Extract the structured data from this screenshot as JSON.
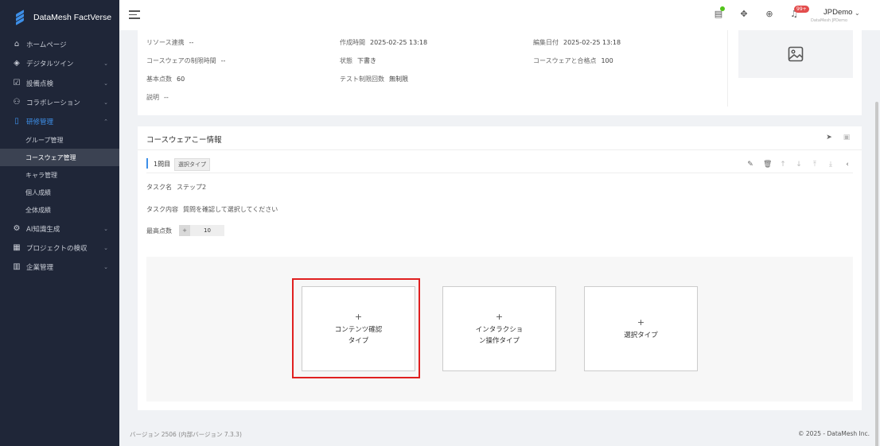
{
  "brand": {
    "name": "DataMesh FactVerse"
  },
  "sidebar": {
    "items": [
      {
        "label": "ホームページ",
        "icon": "home-icon",
        "chevron": false
      },
      {
        "label": "デジタルツイン",
        "icon": "cube-icon",
        "chevron": true
      },
      {
        "label": "設備点検",
        "icon": "checklist-icon",
        "chevron": true
      },
      {
        "label": "コラボレーション",
        "icon": "users-icon",
        "chevron": true
      },
      {
        "label": "研修管理",
        "icon": "book-icon",
        "chevron": true,
        "expanded": true
      }
    ],
    "subitems": [
      {
        "label": "グループ管理"
      },
      {
        "label": "コースウェア管理",
        "selected": true
      },
      {
        "label": "キャラ管理"
      },
      {
        "label": "個人成績"
      },
      {
        "label": "全体成績"
      }
    ],
    "items2": [
      {
        "label": "AI知識生成",
        "icon": "ai-icon",
        "chevron": true
      },
      {
        "label": "プロジェクトの検収",
        "icon": "calendar-icon",
        "chevron": true
      },
      {
        "label": "企業管理",
        "icon": "building-icon",
        "chevron": true
      }
    ]
  },
  "header": {
    "badge": "99+",
    "user_name": "JPDemo",
    "user_sub": "DataMesh JPDemo",
    "icons": [
      "clipboard-icon",
      "robot-icon",
      "globe-icon",
      "bell-icon"
    ]
  },
  "info": {
    "resource_link_label": "リソース連携",
    "resource_link_value": "--",
    "created_label": "作成時間",
    "created_value": "2025-02-25 13:18",
    "edited_label": "編集日付",
    "edited_value": "2025-02-25 13:18",
    "time_limit_label": "コースウェアの制限時間",
    "time_limit_value": "--",
    "status_label": "状態",
    "status_value": "下書き",
    "pass_label": "コースウェアと合格点",
    "pass_value": "100",
    "base_label": "基本点数",
    "base_value": "60",
    "tests_label": "テスト制限回数",
    "tests_value": "無制限",
    "desc_label": "説明",
    "desc_value": "--"
  },
  "courseware": {
    "title": "コースウェアこー情報",
    "question_label": "1問目",
    "question_tag": "選択タイプ",
    "task_name_label": "タスク名",
    "task_name_value": "ステップ2",
    "task_content_label": "タスク内容",
    "task_content_value": "質問を確認して選択してください",
    "max_score_label": "最高点数",
    "max_score_value": "10",
    "stepper_minus": "+",
    "types": [
      {
        "plus": "+",
        "label": "コンテンツ確認\nタイプ"
      },
      {
        "plus": "+",
        "label": "インタラクショ\nン操作タイプ"
      },
      {
        "plus": "+",
        "label": "選択タイプ"
      }
    ]
  },
  "footer": {
    "version": "バージョン 2506 (内部バージョン 7.3.3)",
    "copyright": "© 2025 - DataMesh Inc."
  },
  "colors": {
    "accent": "#3d8fe8",
    "sidebar_bg": "#1f2638",
    "highlight": "#e02020"
  }
}
